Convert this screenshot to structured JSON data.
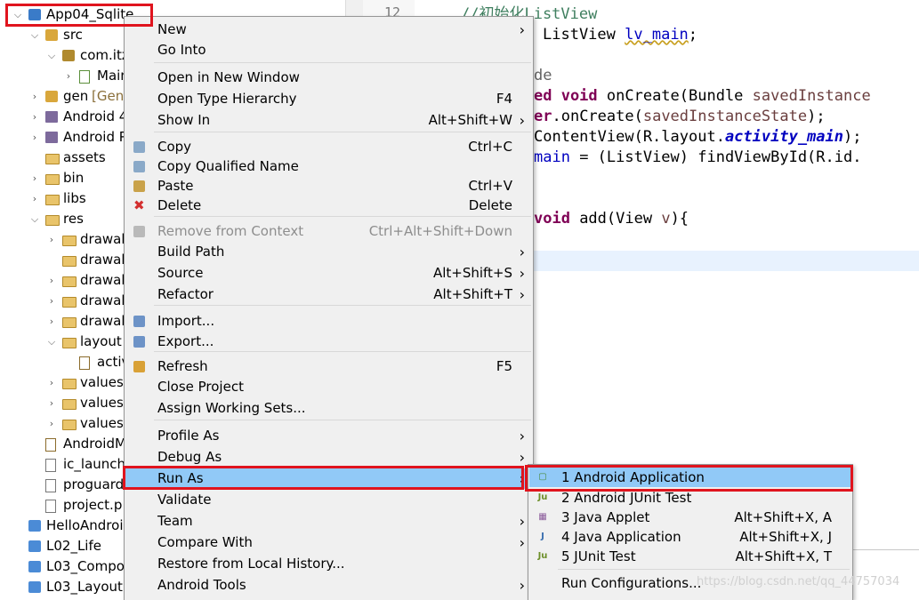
{
  "explorer": {
    "rows": [
      {
        "label": "App04_Sqlite",
        "twisty": "open"
      },
      {
        "label": "src",
        "twisty": "open"
      },
      {
        "label": "com.itz",
        "twisty": "open"
      },
      {
        "label": "Main",
        "twisty": "closed"
      },
      {
        "label": "gen",
        "decoration": "[Gene",
        "twisty": "closed"
      },
      {
        "label": "Android 4",
        "twisty": "closed"
      },
      {
        "label": "Android P",
        "twisty": "closed"
      },
      {
        "label": "assets",
        "twisty": ""
      },
      {
        "label": "bin",
        "twisty": "closed"
      },
      {
        "label": "libs",
        "twisty": "closed"
      },
      {
        "label": "res",
        "twisty": "open"
      },
      {
        "label": "drawab",
        "twisty": "closed"
      },
      {
        "label": "drawab",
        "twisty": ""
      },
      {
        "label": "drawab",
        "twisty": "closed"
      },
      {
        "label": "drawab",
        "twisty": "closed"
      },
      {
        "label": "drawab",
        "twisty": "closed"
      },
      {
        "label": "layout",
        "twisty": "open"
      },
      {
        "label": "activ",
        "twisty": ""
      },
      {
        "label": "values",
        "twisty": "closed"
      },
      {
        "label": "values-",
        "twisty": "closed"
      },
      {
        "label": "values-",
        "twisty": "closed"
      },
      {
        "label": "AndroidM",
        "twisty": ""
      },
      {
        "label": "ic_launch",
        "twisty": ""
      },
      {
        "label": "proguard",
        "twisty": ""
      },
      {
        "label": "project.p",
        "twisty": ""
      },
      {
        "label": "HelloAndroi",
        "twisty": ""
      },
      {
        "label": "L02_Life",
        "twisty": ""
      },
      {
        "label": "L03_Compo",
        "twisty": ""
      },
      {
        "label": "L03_Layout",
        "twisty": ""
      }
    ]
  },
  "ruler": {
    "line_number": "12"
  },
  "editor": {
    "line1": "//初始化ListView",
    "line2_type": "ListView",
    "line2_var": "lv_main",
    "line2_end": ";",
    "line3": "de",
    "line4_kw": "ed void",
    "line4_rest": " onCreate(Bundle ",
    "line4_param": "savedInstance",
    "line5_kw": "er",
    "line5_rest": ".onCreate(",
    "line5_param": "savedInstanceState",
    "line5_end": ");",
    "line6_a": "ContentView(R.layout.",
    "line6_b": "activity_main",
    "line6_c": ");",
    "line7_a": "main",
    "line7_b": " = (ListView) findViewById(R.id.",
    "line8_kw": "void",
    "line8_rest": " add(View ",
    "line8_param": "v",
    "line8_end": "){"
  },
  "context_menu": {
    "items": [
      {
        "label": "New",
        "shortcut": "",
        "submenu": true
      },
      {
        "label": "Go Into",
        "shortcut": ""
      },
      {
        "label": "Open in New Window",
        "shortcut": ""
      },
      {
        "label": "Open Type Hierarchy",
        "shortcut": "F4"
      },
      {
        "label": "Show In",
        "shortcut": "Alt+Shift+W",
        "submenu": true
      },
      {
        "label": "Copy",
        "shortcut": "Ctrl+C",
        "icon": "copy-icon"
      },
      {
        "label": "Copy Qualified Name",
        "shortcut": "",
        "icon": "copy-qualified-icon"
      },
      {
        "label": "Paste",
        "shortcut": "Ctrl+V",
        "icon": "paste-icon"
      },
      {
        "label": "Delete",
        "shortcut": "Delete",
        "icon": "delete-icon"
      },
      {
        "label": "Remove from Context",
        "shortcut": "Ctrl+Alt+Shift+Down",
        "disabled": true,
        "icon": "remove-context-icon"
      },
      {
        "label": "Build Path",
        "shortcut": "",
        "submenu": true
      },
      {
        "label": "Source",
        "shortcut": "Alt+Shift+S",
        "submenu": true
      },
      {
        "label": "Refactor",
        "shortcut": "Alt+Shift+T",
        "submenu": true
      },
      {
        "label": "Import...",
        "shortcut": "",
        "icon": "import-icon"
      },
      {
        "label": "Export...",
        "shortcut": "",
        "icon": "export-icon"
      },
      {
        "label": "Refresh",
        "shortcut": "F5",
        "icon": "refresh-icon"
      },
      {
        "label": "Close Project",
        "shortcut": ""
      },
      {
        "label": "Assign Working Sets...",
        "shortcut": ""
      },
      {
        "label": "Profile As",
        "shortcut": "",
        "submenu": true
      },
      {
        "label": "Debug As",
        "shortcut": "",
        "submenu": true
      },
      {
        "label": "Run As",
        "shortcut": "",
        "submenu": true,
        "highlighted": true
      },
      {
        "label": "Validate",
        "shortcut": ""
      },
      {
        "label": "Team",
        "shortcut": "",
        "submenu": true
      },
      {
        "label": "Compare With",
        "shortcut": "",
        "submenu": true
      },
      {
        "label": "Restore from Local History...",
        "shortcut": ""
      },
      {
        "label": "Android Tools",
        "shortcut": "",
        "submenu": true
      }
    ]
  },
  "run_as_submenu": {
    "items": [
      {
        "label": "1 Android Application",
        "shortcut": "",
        "icon": "android-app-icon",
        "icon_glyph": "▢",
        "highlighted": true
      },
      {
        "label": "2 Android JUnit Test",
        "shortcut": "",
        "icon": "junit-icon",
        "icon_glyph": "Ju"
      },
      {
        "label": "3 Java Applet",
        "shortcut": "Alt+Shift+X, A",
        "icon": "applet-icon",
        "icon_glyph": "▦"
      },
      {
        "label": "4 Java Application",
        "shortcut": "Alt+Shift+X, J",
        "icon": "java-app-icon",
        "icon_glyph": "J"
      },
      {
        "label": "5 JUnit Test",
        "shortcut": "Alt+Shift+X, T",
        "icon": "junit-icon",
        "icon_glyph": "Ju"
      },
      {
        "label": "Run Configurations...",
        "shortcut": ""
      }
    ]
  },
  "colors": {
    "highlight": "#91c9f7",
    "annotation": "#e0141e",
    "menu_bg": "#f0f0f0"
  },
  "watermark": "https://blog.csdn.net/qq_44757034"
}
